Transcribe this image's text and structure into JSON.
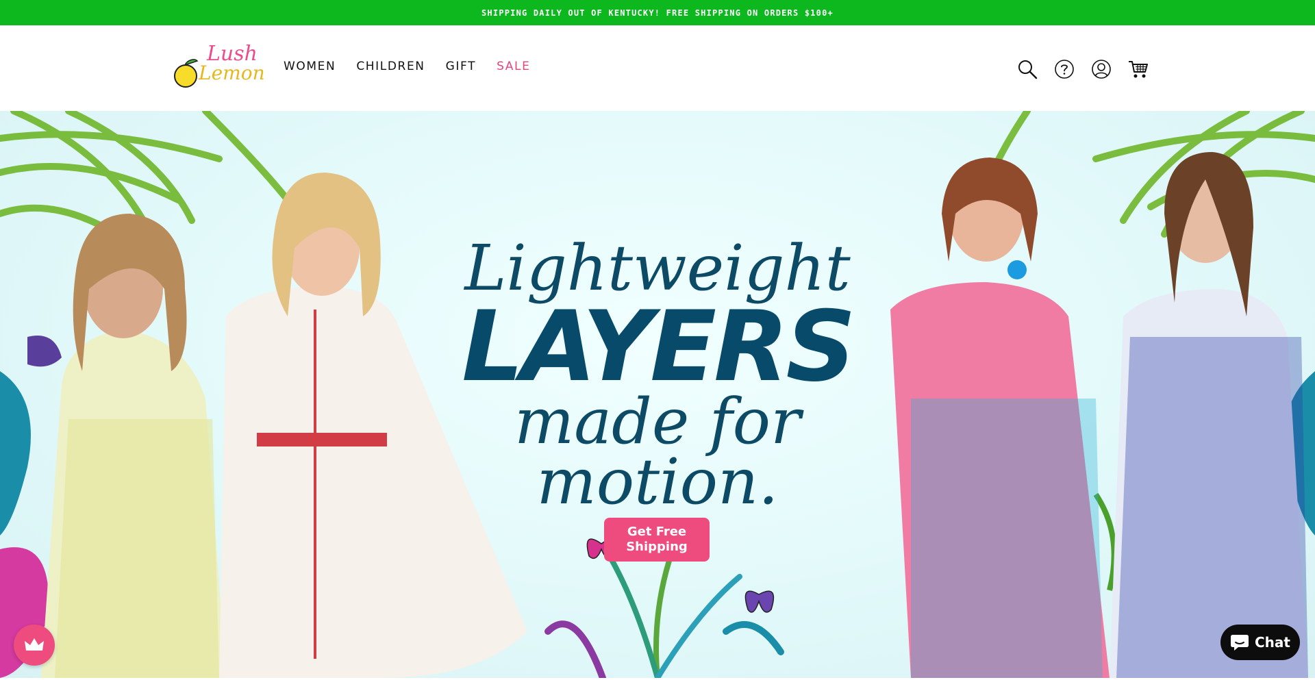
{
  "announcement": {
    "text": "SHIPPING DAILY OUT OF KENTUCKY! FREE SHIPPING ON ORDERS $100+"
  },
  "brand": {
    "line1": "Lush",
    "line2": "Lemon"
  },
  "nav": {
    "items": [
      {
        "label": "WOMEN"
      },
      {
        "label": "CHILDREN"
      },
      {
        "label": "GIFT"
      },
      {
        "label": "SALE"
      }
    ]
  },
  "header_icons": [
    "search-icon",
    "help-icon",
    "account-icon",
    "cart-icon"
  ],
  "hero": {
    "line1": "Lightweight",
    "line2": "LAYERS",
    "line3": "made for",
    "line4": "motion.",
    "cta": {
      "line1": "Get Free",
      "line2": "Shipping"
    }
  },
  "chat": {
    "label": "Chat"
  },
  "colors": {
    "announcement_bg": "#0cb81e",
    "accent_pink": "#ee4c7f",
    "headline_blue": "#0b4a6a",
    "hero_bg": "#e2f9fa"
  }
}
